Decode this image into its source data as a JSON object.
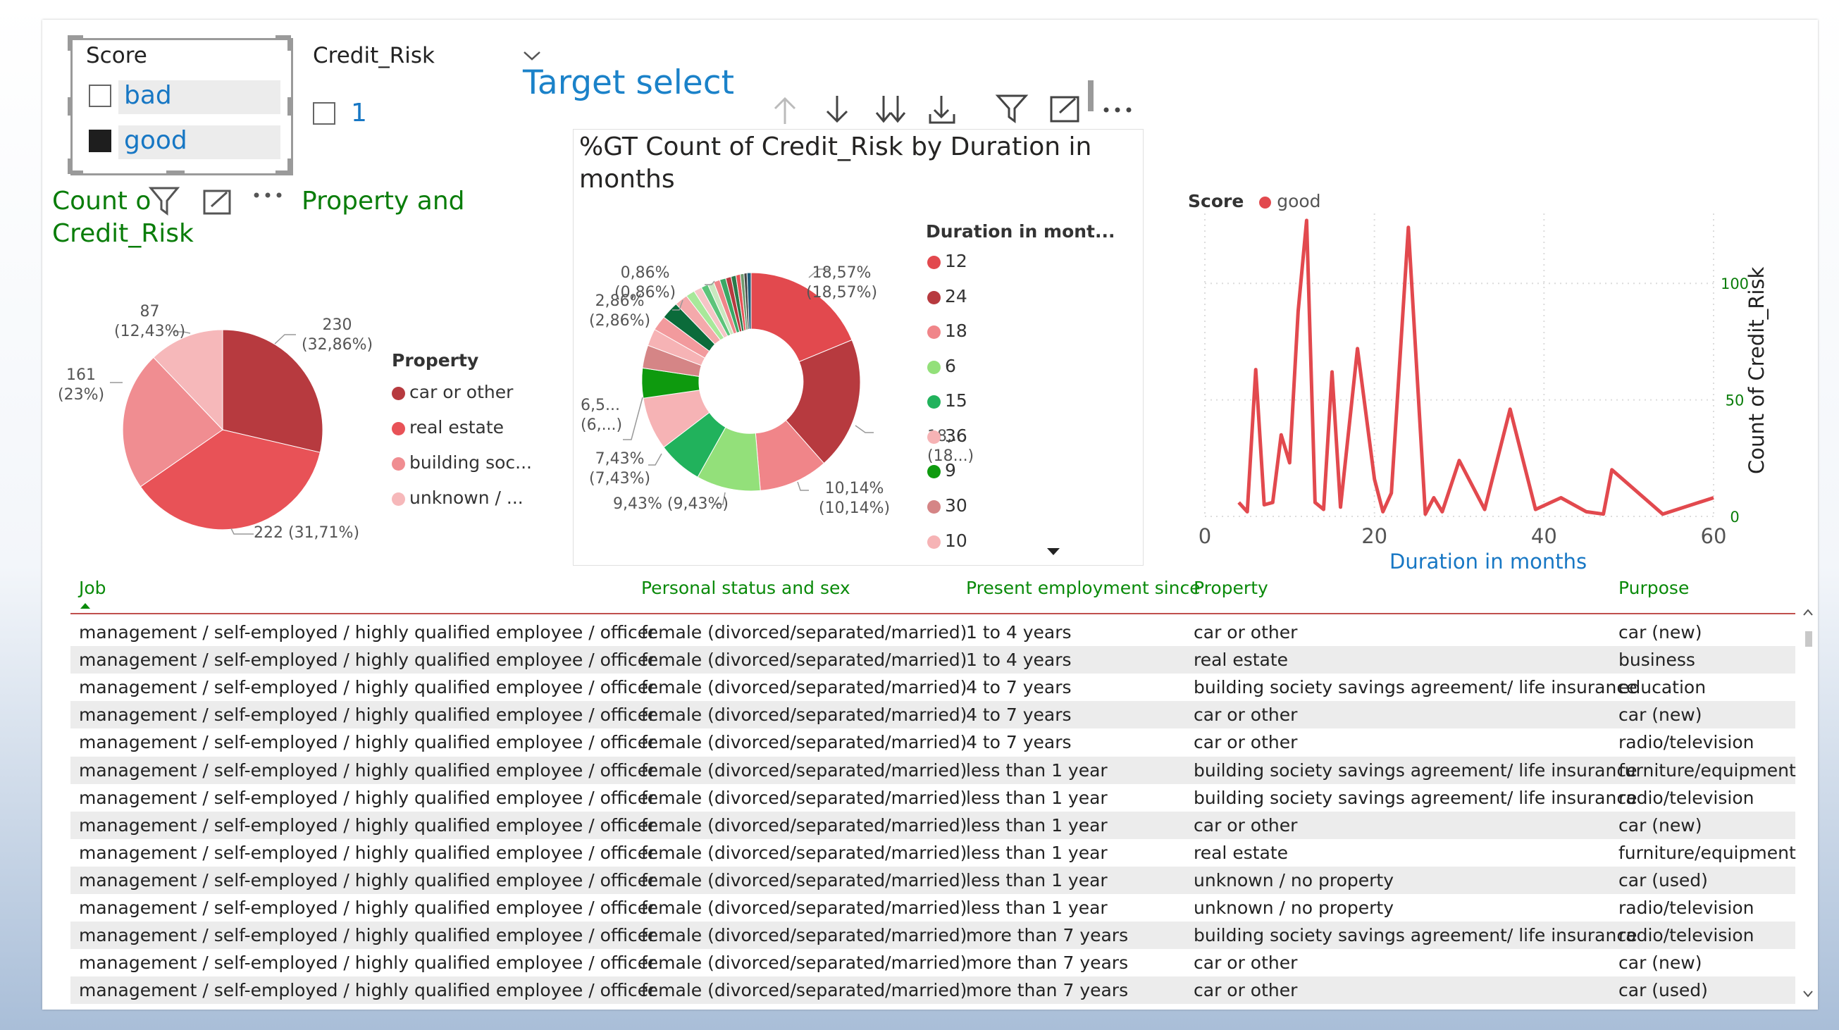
{
  "slicer_score": {
    "title": "Score",
    "options": [
      {
        "label": "bad",
        "checked": false
      },
      {
        "label": "good",
        "checked": true
      }
    ]
  },
  "slicer_credit": {
    "title": "Credit_Risk",
    "options": [
      {
        "label": "1",
        "checked": false
      }
    ]
  },
  "target_select": "Target select",
  "pie": {
    "title_left": "Count o",
    "title_mid": "Property and",
    "title_line2": "Credit_Risk",
    "legend_title": "Property",
    "legend": [
      {
        "label": "car or other",
        "color": "#b73a3f"
      },
      {
        "label": "real estate",
        "color": "#e85257"
      },
      {
        "label": "building soc...",
        "color": "#f08d91"
      },
      {
        "label": "unknown / ...",
        "color": "#f6b8ba"
      }
    ],
    "labels": [
      {
        "a": "230",
        "b": "(32,86%)"
      },
      {
        "a": "222 (31,71%)",
        "b": ""
      },
      {
        "a": "161",
        "b": "(23%)"
      },
      {
        "a": "87",
        "b": "(12,43%)"
      }
    ]
  },
  "donut": {
    "title_line1": "%GT Count of Credit_Risk by Duration in",
    "title_line2": "months",
    "legend_title": "Duration in mont...",
    "legend": [
      {
        "label": "12",
        "color": "#e2494e"
      },
      {
        "label": "24",
        "color": "#b73a3f"
      },
      {
        "label": "18",
        "color": "#f08589"
      },
      {
        "label": "6",
        "color": "#93e07a"
      },
      {
        "label": "15",
        "color": "#21b25c"
      },
      {
        "label": "36",
        "color": "#f6b3b5"
      },
      {
        "label": "9",
        "color": "#0e9a0e"
      },
      {
        "label": "30",
        "color": "#d58586"
      },
      {
        "label": "10",
        "color": "#f6b3b5"
      }
    ],
    "labels": [
      {
        "a": "18,57%",
        "b": "(18,57%)"
      },
      {
        "a": "18,...",
        "b": "(18...)"
      },
      {
        "a": "10,14%",
        "b": "(10,14%)"
      },
      {
        "a": "9,43% (9,43%)",
        "b": ""
      },
      {
        "a": "7,43%",
        "b": "(7,43%)"
      },
      {
        "a": "6,5...",
        "b": "(6,...)"
      },
      {
        "a": "2,86%",
        "b": "(2,86%)"
      },
      {
        "a": "0,86%",
        "b": "(0,86%)"
      }
    ]
  },
  "line_chart": {
    "legend_title": "Score",
    "legend_series": "good",
    "xlabel": "Duration in months",
    "ylabel": "Count of Credit_Risk",
    "x_ticks": [
      "0",
      "20",
      "40",
      "60"
    ],
    "y_ticks": [
      "0",
      "50",
      "100"
    ]
  },
  "chart_data": {
    "type": "line",
    "title": "",
    "xlabel": "Duration in months",
    "ylabel": "Count of Credit_Risk",
    "xlim": [
      0,
      60
    ],
    "ylim": [
      0,
      130
    ],
    "grid": true,
    "legend_placement": "top-left",
    "series": [
      {
        "name": "good",
        "color": "#e2494e",
        "x": [
          4,
          5,
          6,
          7,
          8,
          9,
          10,
          11,
          12,
          13,
          14,
          15,
          16,
          18,
          20,
          21,
          22,
          24,
          26,
          27,
          28,
          30,
          33,
          36,
          39,
          42,
          45,
          47,
          48,
          54,
          60
        ],
        "y": [
          6,
          2,
          63,
          5,
          6,
          35,
          23,
          88,
          127,
          6,
          3,
          62,
          4,
          72,
          16,
          2,
          10,
          124,
          1,
          8,
          2,
          24,
          3,
          46,
          3,
          8,
          2,
          1,
          20,
          1,
          8
        ]
      }
    ]
  },
  "table": {
    "headers": [
      "Job",
      "Personal status and sex",
      "Present employment since",
      "Property",
      "Purpose"
    ],
    "rows": [
      [
        "management / self-employed / highly qualified employee / officer",
        "female (divorced/separated/married)",
        "1 to 4 years",
        "car or other",
        "car (new)"
      ],
      [
        "management / self-employed / highly qualified employee / officer",
        "female (divorced/separated/married)",
        "1 to 4 years",
        "real estate",
        "business"
      ],
      [
        "management / self-employed / highly qualified employee / officer",
        "female (divorced/separated/married)",
        "4 to 7 years",
        "building society savings agreement/ life insurance",
        "education"
      ],
      [
        "management / self-employed / highly qualified employee / officer",
        "female (divorced/separated/married)",
        "4 to 7 years",
        "car or other",
        "car (new)"
      ],
      [
        "management / self-employed / highly qualified employee / officer",
        "female (divorced/separated/married)",
        "4 to 7 years",
        "car or other",
        "radio/television"
      ],
      [
        "management / self-employed / highly qualified employee / officer",
        "female (divorced/separated/married)",
        "less than 1 year",
        "building society savings agreement/ life insurance",
        "furniture/equipment"
      ],
      [
        "management / self-employed / highly qualified employee / officer",
        "female (divorced/separated/married)",
        "less than 1 year",
        "building society savings agreement/ life insurance",
        "radio/television"
      ],
      [
        "management / self-employed / highly qualified employee / officer",
        "female (divorced/separated/married)",
        "less than 1 year",
        "car or other",
        "car (new)"
      ],
      [
        "management / self-employed / highly qualified employee / officer",
        "female (divorced/separated/married)",
        "less than 1 year",
        "real estate",
        "furniture/equipment"
      ],
      [
        "management / self-employed / highly qualified employee / officer",
        "female (divorced/separated/married)",
        "less than 1 year",
        "unknown / no property",
        "car (used)"
      ],
      [
        "management / self-employed / highly qualified employee / officer",
        "female (divorced/separated/married)",
        "less than 1 year",
        "unknown / no property",
        "radio/television"
      ],
      [
        "management / self-employed / highly qualified employee / officer",
        "female (divorced/separated/married)",
        "more than 7 years",
        "building society savings agreement/ life insurance",
        "radio/television"
      ],
      [
        "management / self-employed / highly qualified employee / officer",
        "female (divorced/separated/married)",
        "more than 7 years",
        "car or other",
        "car (new)"
      ],
      [
        "management / self-employed / highly qualified employee / officer",
        "female (divorced/separated/married)",
        "more than 7 years",
        "car or other",
        "car (used)"
      ]
    ]
  }
}
